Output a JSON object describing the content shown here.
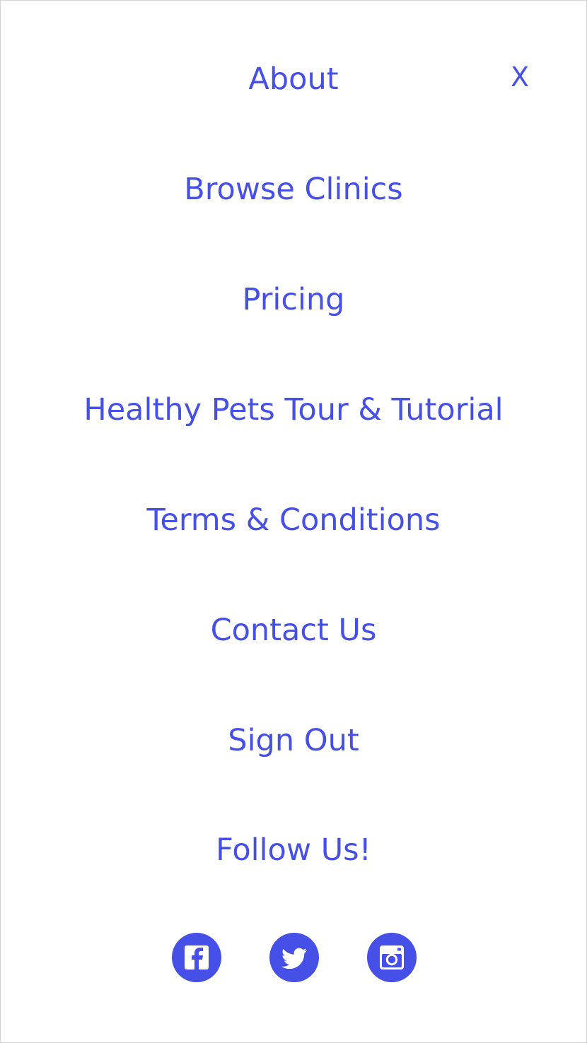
{
  "menu": {
    "close_label": "X",
    "items": [
      {
        "label": "About"
      },
      {
        "label": "Browse Clinics"
      },
      {
        "label": "Pricing"
      },
      {
        "label": "Healthy Pets Tour & Tutorial"
      },
      {
        "label": "Terms & Conditions"
      },
      {
        "label": "Contact Us"
      },
      {
        "label": "Sign Out"
      }
    ]
  },
  "follow": {
    "title": "Follow Us!",
    "icons": [
      {
        "name": "facebook-icon"
      },
      {
        "name": "twitter-icon"
      },
      {
        "name": "instagram-icon"
      }
    ]
  },
  "colors": {
    "accent": "#4650E6",
    "background": "#FFFFFF",
    "border": "#D6D6D6"
  }
}
